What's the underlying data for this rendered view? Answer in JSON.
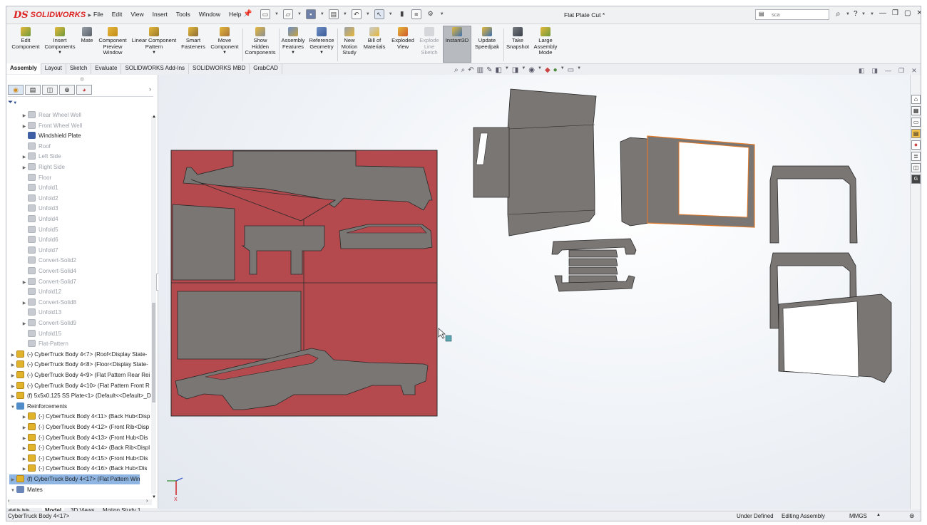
{
  "app": {
    "logo_prefix": "DS",
    "logo_name": "SOLIDWORKS",
    "document_title": "Flat Plate Cut *",
    "search_placeholder": "sca"
  },
  "menus": [
    "File",
    "Edit",
    "View",
    "Insert",
    "Tools",
    "Window",
    "Help"
  ],
  "ribbon": {
    "buttons": [
      {
        "label": "Edit\nComponent",
        "icon": "edit-component-icon"
      },
      {
        "label": "Insert\nComponents",
        "icon": "insert-components-icon"
      },
      {
        "label": "Mate",
        "icon": "mate-icon"
      },
      {
        "label": "Component\nPreview\nWindow",
        "icon": "component-preview-icon"
      },
      {
        "label": "Linear Component\nPattern",
        "icon": "linear-pattern-icon"
      },
      {
        "label": "Smart\nFasteners",
        "icon": "smart-fasteners-icon"
      },
      {
        "label": "Move\nComponent",
        "icon": "move-component-icon"
      },
      {
        "label": "Show\nHidden\nComponents",
        "icon": "show-hidden-icon"
      },
      {
        "label": "Assembly\nFeatures",
        "icon": "assembly-features-icon"
      },
      {
        "label": "Reference\nGeometry",
        "icon": "reference-geometry-icon"
      },
      {
        "label": "New\nMotion\nStudy",
        "icon": "motion-study-icon"
      },
      {
        "label": "Bill of\nMaterials",
        "icon": "bom-icon"
      },
      {
        "label": "Exploded\nView",
        "icon": "exploded-view-icon"
      },
      {
        "label": "Explode\nLine\nSketch",
        "icon": "explode-line-icon"
      },
      {
        "label": "Instant3D",
        "icon": "instant3d-icon"
      },
      {
        "label": "Update\nSpeedpak",
        "icon": "speedpak-icon"
      },
      {
        "label": "Take\nSnapshot",
        "icon": "snapshot-icon"
      },
      {
        "label": "Large\nAssembly\nMode",
        "icon": "large-assembly-icon"
      }
    ]
  },
  "command_tabs": [
    "Assembly",
    "Layout",
    "Sketch",
    "Evaluate",
    "SOLIDWORKS Add-Ins",
    "SOLIDWORKS MBD",
    "GrabCAD"
  ],
  "tree": {
    "items": [
      {
        "label": "Rear Wheel Well",
        "type": "body",
        "arrow": true,
        "dim": true
      },
      {
        "label": "Front Wheel Well",
        "type": "body",
        "arrow": true,
        "dim": true
      },
      {
        "label": "Windshield Plate",
        "type": "bodyd",
        "arrow": false,
        "dim": false
      },
      {
        "label": "Roof",
        "type": "body",
        "arrow": false,
        "dim": true
      },
      {
        "label": "Left Side",
        "type": "body",
        "arrow": true,
        "dim": true
      },
      {
        "label": "Right Side",
        "type": "body",
        "arrow": true,
        "dim": true
      },
      {
        "label": "Floor",
        "type": "body",
        "arrow": false,
        "dim": true
      },
      {
        "label": "Unfold1",
        "type": "body",
        "arrow": false,
        "dim": true
      },
      {
        "label": "Unfold2",
        "type": "body",
        "arrow": false,
        "dim": true
      },
      {
        "label": "Unfold3",
        "type": "body",
        "arrow": false,
        "dim": true
      },
      {
        "label": "Unfold4",
        "type": "body",
        "arrow": false,
        "dim": true
      },
      {
        "label": "Unfold5",
        "type": "body",
        "arrow": false,
        "dim": true
      },
      {
        "label": "Unfold6",
        "type": "body",
        "arrow": false,
        "dim": true
      },
      {
        "label": "Unfold7",
        "type": "body",
        "arrow": false,
        "dim": true
      },
      {
        "label": "Convert-Solid2",
        "type": "body",
        "arrow": false,
        "dim": true
      },
      {
        "label": "Convert-Solid4",
        "type": "body",
        "arrow": false,
        "dim": true
      },
      {
        "label": "Convert-Solid7",
        "type": "body",
        "arrow": true,
        "dim": true
      },
      {
        "label": "Unfold12",
        "type": "body",
        "arrow": false,
        "dim": true
      },
      {
        "label": "Convert-Solid8",
        "type": "body",
        "arrow": true,
        "dim": true
      },
      {
        "label": "Unfold13",
        "type": "body",
        "arrow": false,
        "dim": true
      },
      {
        "label": "Convert-Solid9",
        "type": "body",
        "arrow": true,
        "dim": true
      },
      {
        "label": "Unfold15",
        "type": "body",
        "arrow": false,
        "dim": true
      },
      {
        "label": "Flat-Pattern",
        "type": "body",
        "arrow": false,
        "dim": true
      }
    ],
    "components": [
      "(-) CyberTruck Body 4<7> (Roof<Display State-",
      "(-) CyberTruck Body 4<8> (Floor<Display State-",
      "(-) CyberTruck Body 4<9> (Flat Pattern Rear Rei",
      "(-) CyberTruck Body 4<10> (Flat Pattern Front R",
      "(f) 5x5x0.125 SS Plate<1> (Default<<Default>_D"
    ],
    "folder": "Reinforcements",
    "reinforcements": [
      "(-) CyberTruck Body 4<11> (Back Hub<Disp",
      "(-) CyberTruck Body 4<12> (Front Rib<Disp",
      "(-) CyberTruck Body 4<13> (Front Hub<Dis",
      "(-) CyberTruck Body 4<14> (Back Rib<Displ",
      "(-) CyberTruck Body 4<15> (Front Hub<Dis",
      "(-) CyberTruck Body 4<16> (Back Hub<Dis"
    ],
    "selected": "(f) CyberTruck Body 4<17> (Flat Pattern Win",
    "mates": "Mates"
  },
  "bottom_tabs": [
    "Model",
    "3D Views",
    "Motion Study 1"
  ],
  "status": {
    "selection": "CyberTruck Body 4<17>",
    "state": "Under Defined",
    "mode": "Editing Assembly",
    "units": "MMGS"
  },
  "axis_label": "X",
  "colors": {
    "plate": "#b44a4e",
    "part": "#7a7674",
    "outline": "#2a2a2a",
    "highlight": "#e07a2a"
  }
}
